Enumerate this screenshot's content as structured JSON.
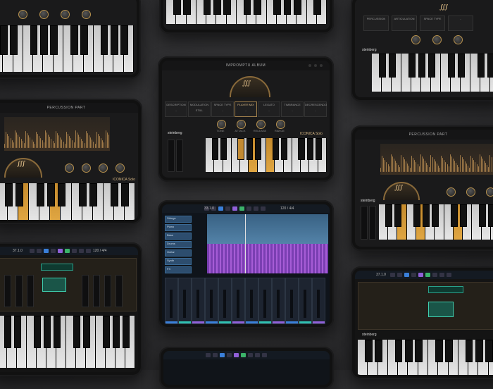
{
  "central_synth": {
    "header_label": "IMPROMPTU ALBUM",
    "params": [
      {
        "label": "DESCRIPTION",
        "value": "-"
      },
      {
        "label": "MODULATION",
        "value": "STILL"
      },
      {
        "label": "SPACE TYPE",
        "value": "-"
      },
      {
        "label": "PLAYER MIX",
        "value": "-"
      },
      {
        "label": "LEGATO",
        "value": "-"
      },
      {
        "label": "TIMBRANCE",
        "value": "-"
      },
      {
        "label": "DECRESCENDO",
        "value": "-"
      }
    ],
    "knobs": [
      "TONE",
      "ATTACK",
      "RELEASE",
      "RANGE"
    ],
    "brand": "steinberg",
    "product": "ICONICA Solo"
  },
  "left_synth": {
    "header_label": "PERCUSSION PART",
    "brand": "steinberg",
    "product": "ICONICA Solo",
    "knobs": [
      "TONE",
      "ATTACK",
      "RELEASE",
      "RANGE"
    ]
  },
  "right_synth": {
    "header_label": "PERCUSSION PART",
    "brand": "steinberg",
    "knobs": [
      "TONE",
      "ATTACK",
      "RANGE"
    ]
  },
  "top_right": {
    "params": [
      "PERCUSSION",
      "ARTICULATION",
      "SPACE TYPE",
      "-"
    ],
    "brand": "steinberg"
  },
  "cubase": {
    "timecode": "33.1.0",
    "tempo": "120 / 4/4",
    "tracks": [
      {
        "name": "Strings"
      },
      {
        "name": "Piano"
      },
      {
        "name": "Bass"
      },
      {
        "name": "Drums"
      },
      {
        "name": "Guitar"
      },
      {
        "name": "Synth"
      },
      {
        "name": "FX"
      }
    ]
  },
  "left_cubase_rack": {
    "timecode": "37.1.0",
    "tempo": "120 / 4/4"
  },
  "right_cubase_rack": {
    "timecode": "37.1.0",
    "brand": "steinberg"
  },
  "colors": {
    "accent_gold": "#c89440",
    "cubase_blue": "#3a7fd9",
    "cubase_purple": "#9060d8",
    "cubase_teal": "#2fc0b0"
  }
}
